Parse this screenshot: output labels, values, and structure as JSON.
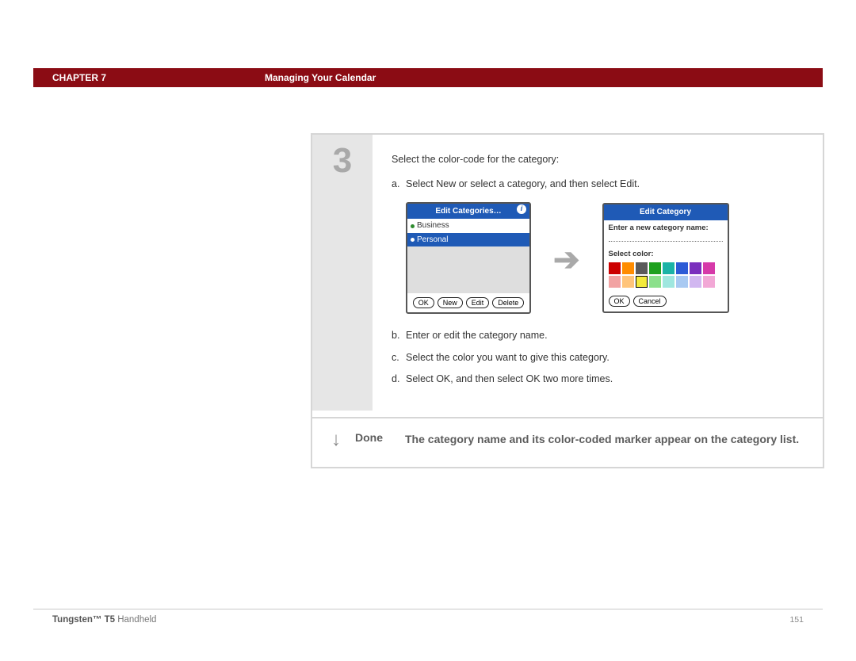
{
  "header": {
    "chapter": "CHAPTER 7",
    "title": "Managing Your Calendar"
  },
  "step": {
    "number": "3",
    "intro": "Select the color-code for the category:",
    "items": [
      {
        "label": "a.",
        "text": "Select New or select a category, and then select Edit."
      },
      {
        "label": "b.",
        "text": "Enter or edit the category name."
      },
      {
        "label": "c.",
        "text": "Select the color you want to give this category."
      },
      {
        "label": "d.",
        "text": "Select OK, and then select OK two more times."
      }
    ]
  },
  "dlg1": {
    "title": "Edit Categories…",
    "categories": [
      {
        "name": "Business",
        "color": "#2e8b2e",
        "selected": false
      },
      {
        "name": "Personal",
        "color": "#1f5ab6",
        "selected": true
      }
    ],
    "buttons": {
      "ok": "OK",
      "new_": "New",
      "edit": "Edit",
      "delete_": "Delete"
    }
  },
  "dlg2": {
    "title": "Edit Category",
    "name_label": "Enter a new category name:",
    "color_label": "Select color:",
    "colors_row1": [
      "#cc0000",
      "#ff8c00",
      "#5a5a5a",
      "#1ea01e",
      "#1bb3a6",
      "#2d5bd6",
      "#7a2fbd",
      "#d63aa9"
    ],
    "colors_row2": [
      "#f2a3a3",
      "#ffc47a",
      "#f3ea3a",
      "#8be08b",
      "#9fe7df",
      "#a8c9f2",
      "#d1b7f0",
      "#f2a8d6"
    ],
    "selected_index": 10,
    "buttons": {
      "ok": "OK",
      "cancel": "Cancel"
    }
  },
  "done": {
    "label": "Done",
    "text": "The category name and its color-coded marker appear on the category list."
  },
  "footer": {
    "product_bold": "Tungsten™ T5",
    "product_rest": " Handheld",
    "page": "151"
  }
}
